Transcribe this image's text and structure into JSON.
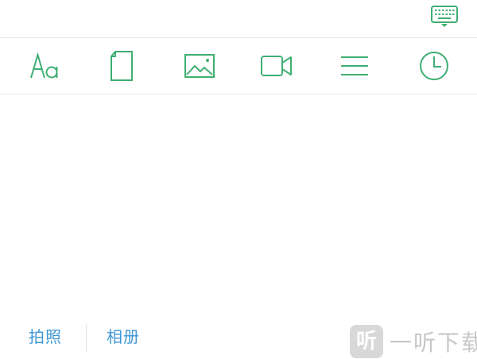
{
  "colors": {
    "accent_green": "#3fae72",
    "link_blue": "#3f97d6",
    "divider": "#e6e6e6"
  },
  "keyboard_toggle": {
    "icon": "keyboard-dismiss-icon"
  },
  "toolbar": {
    "items": [
      {
        "icon": "text-format-icon",
        "label": "Aa"
      },
      {
        "icon": "document-icon"
      },
      {
        "icon": "image-icon"
      },
      {
        "icon": "video-camera-icon"
      },
      {
        "icon": "list-icon"
      },
      {
        "icon": "clock-icon"
      }
    ]
  },
  "bottom_bar": {
    "take_photo_label": "拍照",
    "album_label": "相册"
  },
  "watermark": {
    "logo_char": "听",
    "text": "一听下载"
  }
}
